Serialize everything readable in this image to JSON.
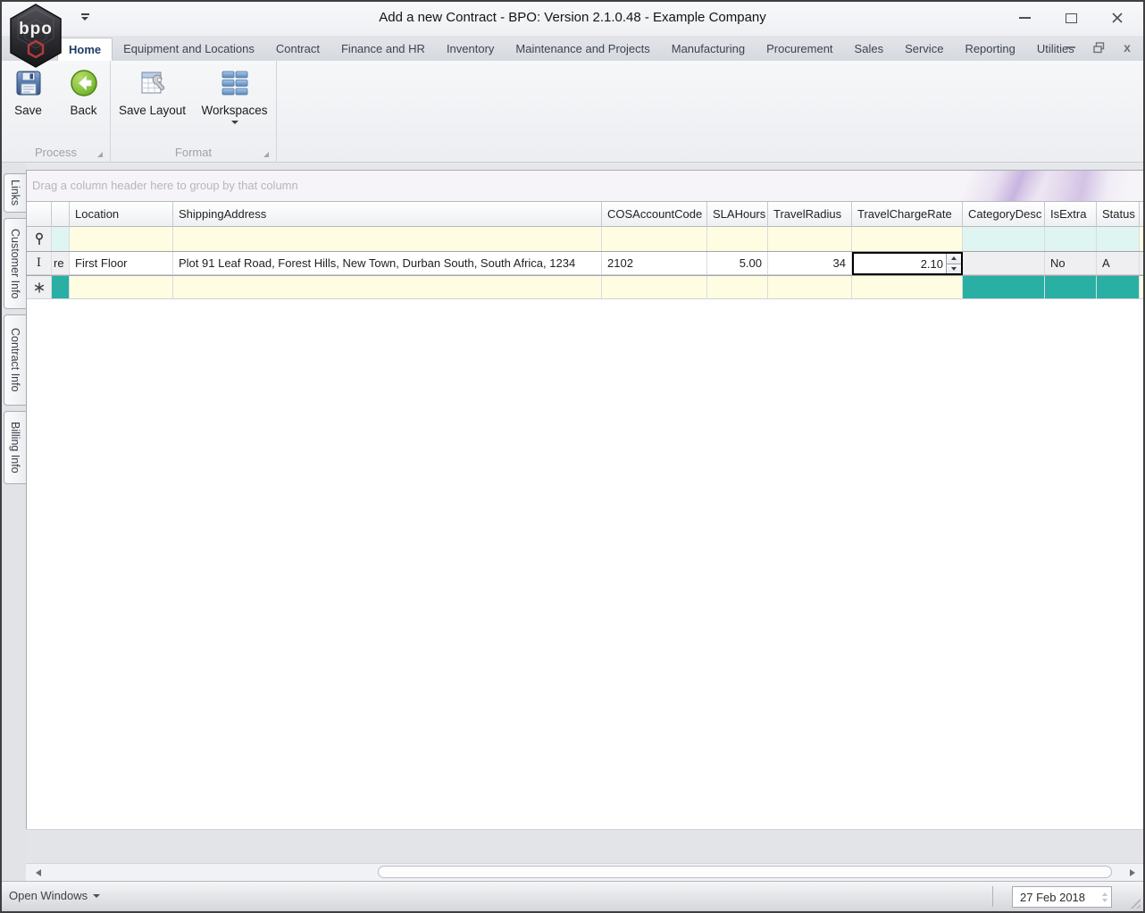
{
  "window": {
    "title": "Add a new Contract - BPO: Version 2.1.0.48 - Example Company",
    "logo_text": "bpo"
  },
  "ribbon": {
    "tabs": [
      "Home",
      "Equipment and Locations",
      "Contract",
      "Finance and HR",
      "Inventory",
      "Maintenance and Projects",
      "Manufacturing",
      "Procurement",
      "Sales",
      "Service",
      "Reporting",
      "Utilities"
    ],
    "active_tab": "Home",
    "groups": [
      {
        "caption": "Process",
        "buttons": [
          "Save",
          "Back"
        ]
      },
      {
        "caption": "Format",
        "buttons": [
          "Save Layout",
          "Workspaces"
        ]
      }
    ]
  },
  "side_tabs": [
    "Links",
    "Customer Info",
    "Contract Info",
    "Billing Info"
  ],
  "grid": {
    "group_panel_text": "Drag a column header here to group by that column",
    "columns": [
      "Location",
      "ShippingAddress",
      "COSAccountCode",
      "SLAHours",
      "TravelRadius",
      "TravelChargeRate",
      "CategoryDesc",
      "IsExtra",
      "Status"
    ],
    "row": {
      "clipped_text": "re",
      "location": "First Floor",
      "shipping_address": "Plot 91 Leaf Road, Forest Hills, New Town, Durban South, South Africa, 1234",
      "cos_account_code": "2102",
      "sla_hours": "5.00",
      "travel_radius": "34",
      "travel_charge_rate": "2.10",
      "category_desc": "",
      "is_extra": "No",
      "status": "A"
    }
  },
  "status_bar": {
    "open_windows": "Open Windows",
    "date": "27 Feb 2018"
  },
  "colors": {
    "new_row_teal": "#29AFA3",
    "filter_yellow": "#FFFDE1",
    "readonly_cyan": "#DFF5F1",
    "back_green": "#7DBB3C",
    "icon_blue": "#5B87B8"
  }
}
